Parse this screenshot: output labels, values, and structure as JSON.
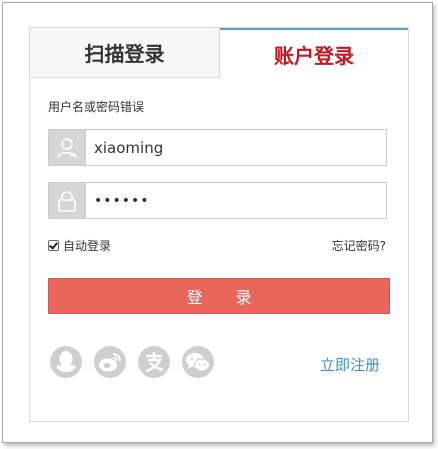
{
  "tabs": {
    "qr_label": "扫描登录",
    "account_label": "账户登录",
    "active": "account"
  },
  "error_message": "用户名或密码错误",
  "form": {
    "username_value": "xiaoming",
    "password_value": "••••••",
    "username_icon": "user-icon",
    "password_icon": "lock-icon"
  },
  "options": {
    "auto_login_label": "自动登录",
    "auto_login_checked": true,
    "forgot_label": "忘记密码?"
  },
  "login_button": {
    "label": "登 录"
  },
  "social": {
    "icons": [
      "qq-icon",
      "weibo-icon",
      "alipay-icon",
      "wechat-icon"
    ]
  },
  "register_label": "立即注册",
  "colors": {
    "active_tab_text": "#c81623",
    "active_tab_border": "#5aa5c8",
    "login_button": "#e8665a",
    "register_link": "#3d8fcf",
    "icon_gray": "#cfcfcf"
  }
}
